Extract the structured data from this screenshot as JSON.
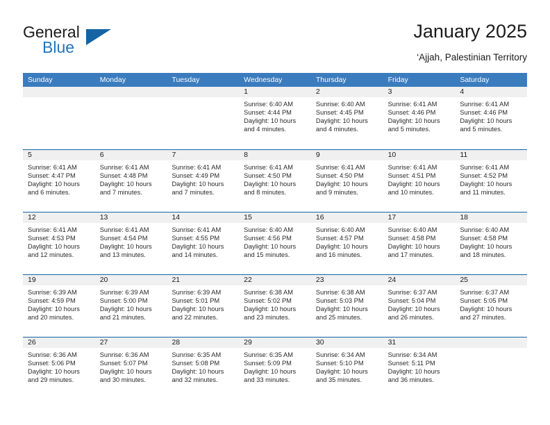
{
  "logo": {
    "word1": "General",
    "word2": "Blue",
    "triangle_color": "#1464a5",
    "blue_text_color": "#2175bd"
  },
  "header": {
    "title": "January 2025",
    "subtitle": "‘Ajjah, Palestinian Territory"
  },
  "theme": {
    "header_bar_color": "#3a7cbe",
    "row_divider_color": "#1464a5",
    "day_band_color": "#f0f0f0",
    "text_color": "#1b1b1b"
  },
  "weekdays": [
    "Sunday",
    "Monday",
    "Tuesday",
    "Wednesday",
    "Thursday",
    "Friday",
    "Saturday"
  ],
  "weeks": [
    [
      {
        "day": "",
        "empty": true
      },
      {
        "day": "",
        "empty": true
      },
      {
        "day": "",
        "empty": true
      },
      {
        "day": "1",
        "sunrise": "Sunrise: 6:40 AM",
        "sunset": "Sunset: 4:44 PM",
        "daylight": "Daylight: 10 hours and 4 minutes."
      },
      {
        "day": "2",
        "sunrise": "Sunrise: 6:40 AM",
        "sunset": "Sunset: 4:45 PM",
        "daylight": "Daylight: 10 hours and 4 minutes."
      },
      {
        "day": "3",
        "sunrise": "Sunrise: 6:41 AM",
        "sunset": "Sunset: 4:46 PM",
        "daylight": "Daylight: 10 hours and 5 minutes."
      },
      {
        "day": "4",
        "sunrise": "Sunrise: 6:41 AM",
        "sunset": "Sunset: 4:46 PM",
        "daylight": "Daylight: 10 hours and 5 minutes."
      }
    ],
    [
      {
        "day": "5",
        "sunrise": "Sunrise: 6:41 AM",
        "sunset": "Sunset: 4:47 PM",
        "daylight": "Daylight: 10 hours and 6 minutes."
      },
      {
        "day": "6",
        "sunrise": "Sunrise: 6:41 AM",
        "sunset": "Sunset: 4:48 PM",
        "daylight": "Daylight: 10 hours and 7 minutes."
      },
      {
        "day": "7",
        "sunrise": "Sunrise: 6:41 AM",
        "sunset": "Sunset: 4:49 PM",
        "daylight": "Daylight: 10 hours and 7 minutes."
      },
      {
        "day": "8",
        "sunrise": "Sunrise: 6:41 AM",
        "sunset": "Sunset: 4:50 PM",
        "daylight": "Daylight: 10 hours and 8 minutes."
      },
      {
        "day": "9",
        "sunrise": "Sunrise: 6:41 AM",
        "sunset": "Sunset: 4:50 PM",
        "daylight": "Daylight: 10 hours and 9 minutes."
      },
      {
        "day": "10",
        "sunrise": "Sunrise: 6:41 AM",
        "sunset": "Sunset: 4:51 PM",
        "daylight": "Daylight: 10 hours and 10 minutes."
      },
      {
        "day": "11",
        "sunrise": "Sunrise: 6:41 AM",
        "sunset": "Sunset: 4:52 PM",
        "daylight": "Daylight: 10 hours and 11 minutes."
      }
    ],
    [
      {
        "day": "12",
        "sunrise": "Sunrise: 6:41 AM",
        "sunset": "Sunset: 4:53 PM",
        "daylight": "Daylight: 10 hours and 12 minutes."
      },
      {
        "day": "13",
        "sunrise": "Sunrise: 6:41 AM",
        "sunset": "Sunset: 4:54 PM",
        "daylight": "Daylight: 10 hours and 13 minutes."
      },
      {
        "day": "14",
        "sunrise": "Sunrise: 6:41 AM",
        "sunset": "Sunset: 4:55 PM",
        "daylight": "Daylight: 10 hours and 14 minutes."
      },
      {
        "day": "15",
        "sunrise": "Sunrise: 6:40 AM",
        "sunset": "Sunset: 4:56 PM",
        "daylight": "Daylight: 10 hours and 15 minutes."
      },
      {
        "day": "16",
        "sunrise": "Sunrise: 6:40 AM",
        "sunset": "Sunset: 4:57 PM",
        "daylight": "Daylight: 10 hours and 16 minutes."
      },
      {
        "day": "17",
        "sunrise": "Sunrise: 6:40 AM",
        "sunset": "Sunset: 4:58 PM",
        "daylight": "Daylight: 10 hours and 17 minutes."
      },
      {
        "day": "18",
        "sunrise": "Sunrise: 6:40 AM",
        "sunset": "Sunset: 4:58 PM",
        "daylight": "Daylight: 10 hours and 18 minutes."
      }
    ],
    [
      {
        "day": "19",
        "sunrise": "Sunrise: 6:39 AM",
        "sunset": "Sunset: 4:59 PM",
        "daylight": "Daylight: 10 hours and 20 minutes."
      },
      {
        "day": "20",
        "sunrise": "Sunrise: 6:39 AM",
        "sunset": "Sunset: 5:00 PM",
        "daylight": "Daylight: 10 hours and 21 minutes."
      },
      {
        "day": "21",
        "sunrise": "Sunrise: 6:39 AM",
        "sunset": "Sunset: 5:01 PM",
        "daylight": "Daylight: 10 hours and 22 minutes."
      },
      {
        "day": "22",
        "sunrise": "Sunrise: 6:38 AM",
        "sunset": "Sunset: 5:02 PM",
        "daylight": "Daylight: 10 hours and 23 minutes."
      },
      {
        "day": "23",
        "sunrise": "Sunrise: 6:38 AM",
        "sunset": "Sunset: 5:03 PM",
        "daylight": "Daylight: 10 hours and 25 minutes."
      },
      {
        "day": "24",
        "sunrise": "Sunrise: 6:37 AM",
        "sunset": "Sunset: 5:04 PM",
        "daylight": "Daylight: 10 hours and 26 minutes."
      },
      {
        "day": "25",
        "sunrise": "Sunrise: 6:37 AM",
        "sunset": "Sunset: 5:05 PM",
        "daylight": "Daylight: 10 hours and 27 minutes."
      }
    ],
    [
      {
        "day": "26",
        "sunrise": "Sunrise: 6:36 AM",
        "sunset": "Sunset: 5:06 PM",
        "daylight": "Daylight: 10 hours and 29 minutes."
      },
      {
        "day": "27",
        "sunrise": "Sunrise: 6:36 AM",
        "sunset": "Sunset: 5:07 PM",
        "daylight": "Daylight: 10 hours and 30 minutes."
      },
      {
        "day": "28",
        "sunrise": "Sunrise: 6:35 AM",
        "sunset": "Sunset: 5:08 PM",
        "daylight": "Daylight: 10 hours and 32 minutes."
      },
      {
        "day": "29",
        "sunrise": "Sunrise: 6:35 AM",
        "sunset": "Sunset: 5:09 PM",
        "daylight": "Daylight: 10 hours and 33 minutes."
      },
      {
        "day": "30",
        "sunrise": "Sunrise: 6:34 AM",
        "sunset": "Sunset: 5:10 PM",
        "daylight": "Daylight: 10 hours and 35 minutes."
      },
      {
        "day": "31",
        "sunrise": "Sunrise: 6:34 AM",
        "sunset": "Sunset: 5:11 PM",
        "daylight": "Daylight: 10 hours and 36 minutes."
      },
      {
        "day": "",
        "empty": true
      }
    ]
  ]
}
